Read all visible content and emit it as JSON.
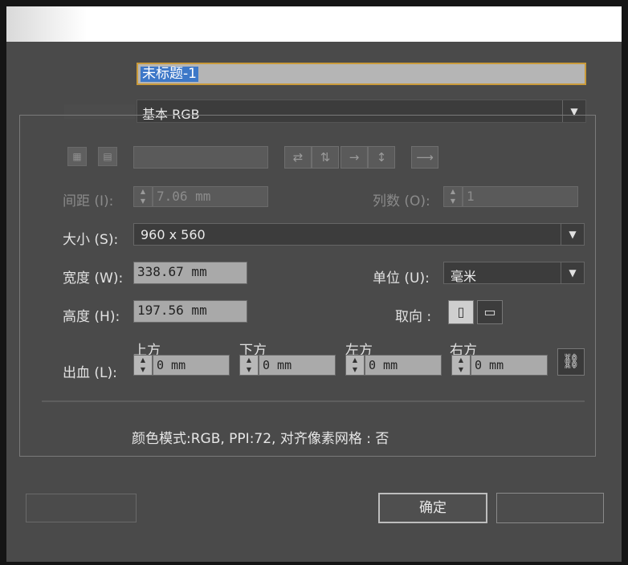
{
  "document": {
    "name": "未标题-1",
    "profile": "基本 RGB"
  },
  "spacing": {
    "label": "间距 (I):",
    "value": "7.06 mm"
  },
  "columns": {
    "label": "列数 (O):",
    "value": "1"
  },
  "size": {
    "label": "大小 (S):",
    "value": "960 x 560"
  },
  "width": {
    "label": "宽度 (W):",
    "value": "338.67 mm"
  },
  "height": {
    "label": "高度 (H):",
    "value": "197.56 mm"
  },
  "units": {
    "label": "单位 (U):",
    "value": "毫米"
  },
  "orientation": {
    "label": "取向 :"
  },
  "bleed": {
    "label": "出血 (L):",
    "top": {
      "label": "上方",
      "value": "0 mm"
    },
    "bottom": {
      "label": "下方",
      "value": "0 mm"
    },
    "left": {
      "label": "左方",
      "value": "0 mm"
    },
    "right": {
      "label": "右方",
      "value": "0 mm"
    }
  },
  "info": "颜色模式:RGB, PPI:72, 对齐像素网格 : 否",
  "buttons": {
    "ok": "确定"
  },
  "icons": {
    "artboards_grid": "grid-by-row-icon",
    "artboards_col": "grid-by-column-icon",
    "arrange_row": "arrange-by-row-icon",
    "arrange_col": "arrange-by-column-icon",
    "layout_direction": "right-to-left-arrow-icon",
    "link": "chain-link-icon",
    "portrait": "portrait-icon",
    "landscape": "landscape-icon"
  },
  "colors": {
    "accent_border": "#c99a3a",
    "selection": "#3d78c8"
  }
}
